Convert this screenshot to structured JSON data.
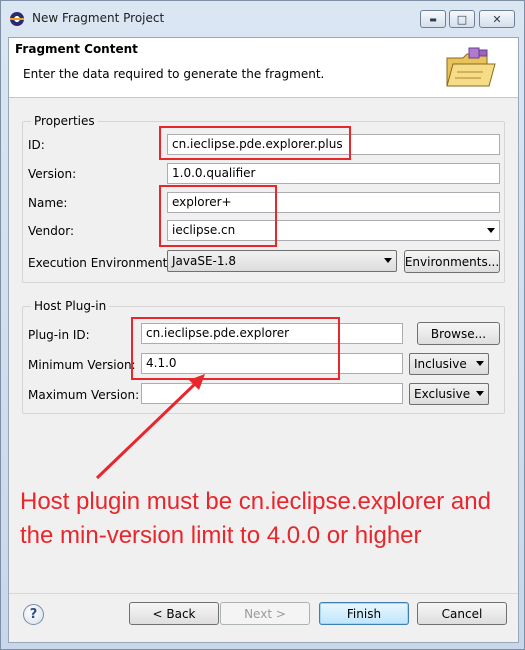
{
  "window": {
    "title": "New Fragment Project",
    "min_icon": "minimize-icon",
    "max_icon": "maximize-icon",
    "close_icon": "close-icon",
    "min_glyph": "▬",
    "max_glyph": "□",
    "close_glyph": "✕"
  },
  "header": {
    "title": "Fragment Content",
    "description": "Enter the data required to generate the fragment.",
    "image_icon": "folder-plugin-icon"
  },
  "properties": {
    "group_label": "Properties",
    "id_label": "ID:",
    "id_value": "cn.ieclipse.pde.explorer.plus",
    "version_label": "Version:",
    "version_value": "1.0.0.qualifier",
    "name_label": "Name:",
    "name_value": "explorer+",
    "vendor_label": "Vendor:",
    "vendor_value": "ieclipse.cn",
    "env_label": "Execution Environment:",
    "env_value": "JavaSE-1.8",
    "environments_button": "Environments..."
  },
  "host": {
    "group_label": "Host Plug-in",
    "plugin_id_label": "Plug-in ID:",
    "plugin_id_value": "cn.ieclipse.pde.explorer",
    "browse_button": "Browse...",
    "min_version_label": "Minimum Version:",
    "min_version_value": "4.1.0",
    "min_version_mode": "Inclusive",
    "max_version_label": "Maximum Version:",
    "max_version_value": "",
    "max_version_mode": "Exclusive"
  },
  "annotation": {
    "text": "Host plugin must be cn.ieclipse.explorer and the min-version limit to 4.0.0 or higher",
    "color": "#e8262c"
  },
  "footer": {
    "help_glyph": "?",
    "back_button": "< Back",
    "next_button": "Next >",
    "finish_button": "Finish",
    "cancel_button": "Cancel"
  }
}
